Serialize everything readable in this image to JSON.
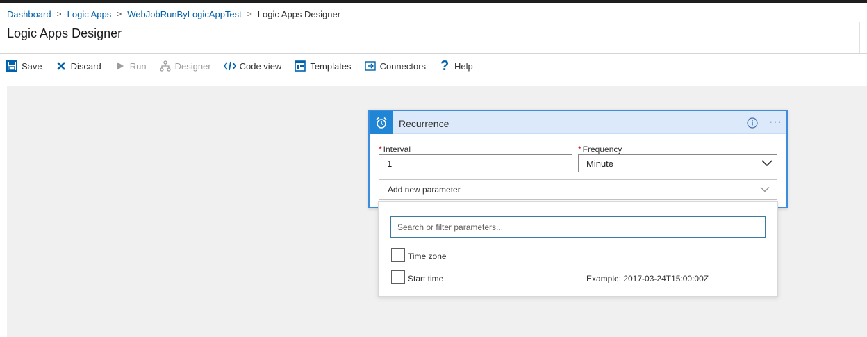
{
  "breadcrumb": {
    "items": [
      "Dashboard",
      "Logic Apps",
      "WebJobRunByLogicAppTest"
    ],
    "current": "Logic Apps Designer"
  },
  "page": {
    "title": "Logic Apps Designer"
  },
  "toolbar": {
    "save": "Save",
    "discard": "Discard",
    "run": "Run",
    "designer": "Designer",
    "code_view": "Code view",
    "templates": "Templates",
    "connectors": "Connectors",
    "help": "Help"
  },
  "card": {
    "title": "Recurrence",
    "icon": "alarm-clock-icon",
    "interval": {
      "label": "Interval",
      "value": "1",
      "required_mark": "*"
    },
    "frequency": {
      "label": "Frequency",
      "value": "Minute",
      "required_mark": "*"
    },
    "add_param": "Add new parameter"
  },
  "dropdown": {
    "search_placeholder": "Search or filter parameters...",
    "options": [
      {
        "label": "Time zone",
        "checked": false
      },
      {
        "label": "Start time",
        "checked": false,
        "example": "Example: 2017-03-24T15:00:00Z"
      }
    ]
  },
  "colors": {
    "accent": "#0062ad",
    "card_border": "#3c8dde",
    "card_header": "#dbe9fb",
    "card_icon_bg": "#1f85d4",
    "canvas": "#f0f0f0",
    "required": "#c50f1f"
  }
}
